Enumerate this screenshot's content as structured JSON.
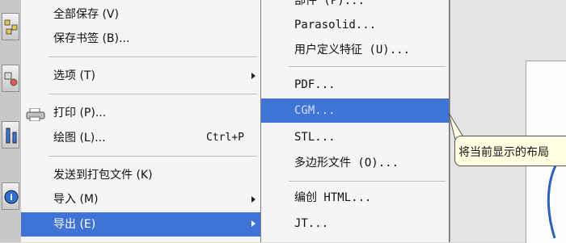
{
  "main_menu": {
    "items": [
      {
        "label": "全部保存 (V)",
        "shortcut": "",
        "submenu": false
      },
      {
        "label": "保存书签 (B)...",
        "shortcut": "",
        "submenu": false
      },
      {
        "label": "选项 (T)",
        "shortcut": "",
        "submenu": true
      },
      {
        "label": "打印 (P)...",
        "shortcut": "",
        "submenu": false
      },
      {
        "label": "绘图 (L)...",
        "shortcut": "Ctrl+P",
        "submenu": false
      },
      {
        "label": "发送到打包文件 (K)",
        "shortcut": "",
        "submenu": false
      },
      {
        "label": "导入 (M)",
        "shortcut": "",
        "submenu": true
      },
      {
        "label": "导出 (E)",
        "shortcut": "",
        "submenu": true,
        "highlighted": true
      }
    ]
  },
  "export_submenu": {
    "items": [
      {
        "label": "部件 (P)..."
      },
      {
        "label": "Parasolid..."
      },
      {
        "label": "用户定义特征 (U)..."
      },
      {
        "label": "PDF..."
      },
      {
        "label": "CGM...",
        "highlighted": true
      },
      {
        "label": "STL..."
      },
      {
        "label": "多边形文件 (O)..."
      },
      {
        "label": "编创 HTML..."
      },
      {
        "label": "JT..."
      }
    ]
  },
  "tooltip": {
    "text": "将当前显示的布局"
  },
  "colors": {
    "highlight": "#3f74d6",
    "menu_bg": "#f5f5f5",
    "tooltip_bg": "#ffffe1"
  },
  "toolbar_icons": [
    "assembly-icon",
    "constraint-icon",
    "measure-icon",
    "info-icon"
  ]
}
